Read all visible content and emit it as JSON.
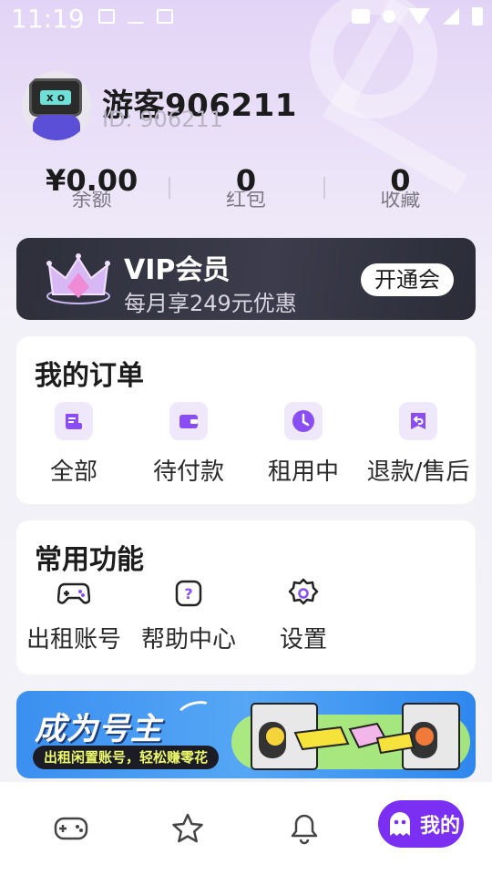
{
  "status_bar": {
    "time": "11:19"
  },
  "profile": {
    "name": "游客906211",
    "id_label": "ID: 906211"
  },
  "stats": [
    {
      "value": "¥0.00",
      "label": "余额"
    },
    {
      "value": "0",
      "label": "红包"
    },
    {
      "value": "0",
      "label": "收藏"
    }
  ],
  "vip": {
    "title": "VIP会员",
    "subtitle": "每月享249元优惠",
    "button": "开通会"
  },
  "orders": {
    "title": "我的订单",
    "items": [
      {
        "label": "全部",
        "icon": "list-icon"
      },
      {
        "label": "待付款",
        "icon": "wallet-icon"
      },
      {
        "label": "租用中",
        "icon": "clock-icon"
      },
      {
        "label": "退款/售后",
        "icon": "refund-icon"
      }
    ]
  },
  "functions": {
    "title": "常用功能",
    "items": [
      {
        "label": "出租账号",
        "icon": "gamepad-icon"
      },
      {
        "label": "帮助中心",
        "icon": "help-icon"
      },
      {
        "label": "设置",
        "icon": "gear-icon"
      }
    ]
  },
  "promo": {
    "title": "成为号主",
    "subtitle": "出租闲置账号，轻松赚零花"
  },
  "bottom_nav": {
    "items": [
      {
        "name": "games",
        "icon": "gamepad-icon"
      },
      {
        "name": "favorites",
        "icon": "star-icon"
      },
      {
        "name": "notifications",
        "icon": "bell-icon"
      }
    ],
    "active_label": "我的"
  },
  "colors": {
    "accent": "#7b2ff2",
    "icon_bg": "#efe8fb",
    "icon_fg": "#8a4df3",
    "vip_bg": "#2e2f3b",
    "promo_bg": "#3b8ff0"
  }
}
